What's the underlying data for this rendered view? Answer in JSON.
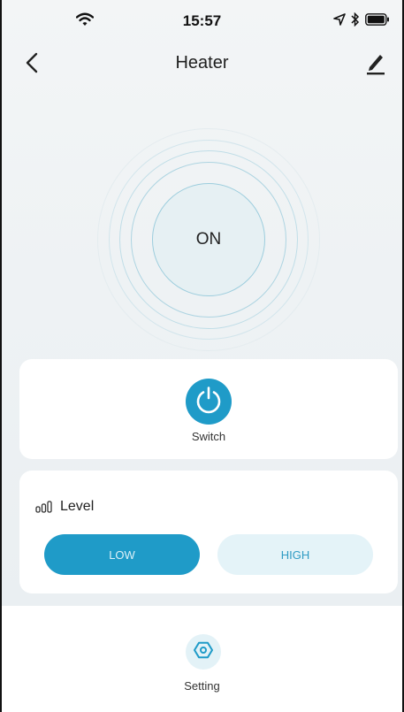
{
  "status_bar": {
    "time": "15:57"
  },
  "nav": {
    "title": "Heater"
  },
  "device": {
    "state_label": "ON"
  },
  "switch_card": {
    "label": "Switch"
  },
  "level_card": {
    "label": "Level",
    "options": [
      "LOW",
      "HIGH"
    ],
    "selected": "LOW"
  },
  "bottom": {
    "setting_label": "Setting"
  },
  "colors": {
    "accent": "#1f9bc8",
    "accent_light": "#e4f3f8"
  },
  "icons": [
    "wifi-icon",
    "location-arrow-icon",
    "bluetooth-icon",
    "battery-icon",
    "back-chevron-icon",
    "edit-pencil-icon",
    "power-icon",
    "signal-bars-icon",
    "hexagon-settings-icon"
  ]
}
